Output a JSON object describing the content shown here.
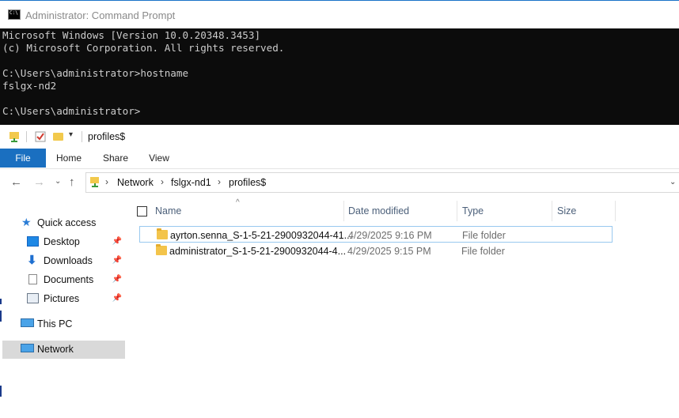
{
  "cmd": {
    "window_title": "Administrator: Command Prompt",
    "lines": [
      "Microsoft Windows [Version 10.0.20348.3453]",
      "(c) Microsoft Corporation. All rights reserved.",
      "",
      "C:\\Users\\administrator>hostname",
      "fslgx-nd2",
      "",
      "C:\\Users\\administrator>"
    ]
  },
  "explorer": {
    "qat_title": "profiles$",
    "ribbon_tabs": [
      "File",
      "Home",
      "Share",
      "View"
    ],
    "breadcrumb": [
      "Network",
      "fslgx-nd1",
      "profiles$"
    ],
    "sidebar": {
      "quick_access": "Quick access",
      "desktop": "Desktop",
      "downloads": "Downloads",
      "documents": "Documents",
      "pictures": "Pictures",
      "this_pc": "This PC",
      "network": "Network"
    },
    "columns": {
      "name": "Name",
      "date": "Date modified",
      "type": "Type",
      "size": "Size"
    },
    "rows": [
      {
        "name": "ayrton.senna_S-1-5-21-2900932044-41...",
        "date": "4/29/2025 9:16 PM",
        "type": "File folder"
      },
      {
        "name": "administrator_S-1-5-21-2900932044-4...",
        "date": "4/29/2025 9:15 PM",
        "type": "File folder"
      }
    ]
  }
}
